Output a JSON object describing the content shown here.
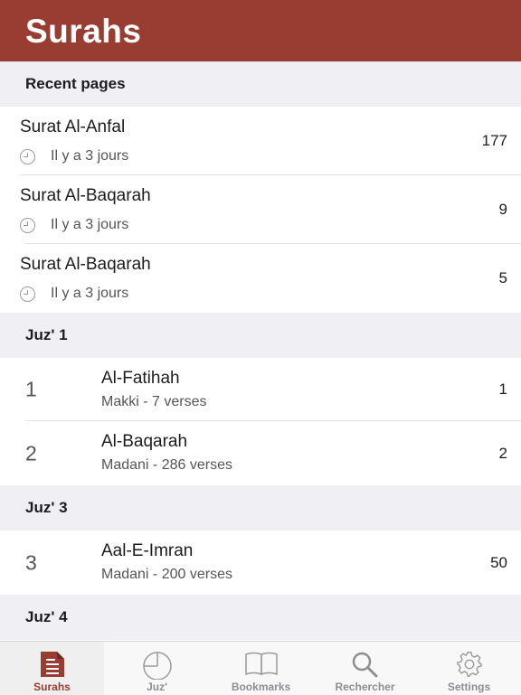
{
  "header": {
    "title": "Surahs"
  },
  "recent": {
    "header": "Recent pages",
    "items": [
      {
        "name": "Surat Al-Anfal",
        "time": "Il y a 3 jours",
        "page": "177"
      },
      {
        "name": "Surat Al-Baqarah",
        "time": "Il y a 3 jours",
        "page": "9"
      },
      {
        "name": "Surat Al-Baqarah",
        "time": "Il y a 3 jours",
        "page": "5"
      }
    ]
  },
  "sections": [
    {
      "header": "Juz' 1",
      "items": [
        {
          "number": "1",
          "name": "Al-Fatihah",
          "info": "Makki - 7 verses",
          "juz": "1"
        },
        {
          "number": "2",
          "name": "Al-Baqarah",
          "info": "Madani - 286 verses",
          "juz": "2"
        }
      ]
    },
    {
      "header": "Juz' 3",
      "items": [
        {
          "number": "3",
          "name": "Aal-E-Imran",
          "info": "Madani - 200 verses",
          "juz": "50"
        }
      ]
    },
    {
      "header": "Juz' 4"
    }
  ],
  "tabbar": {
    "items": [
      {
        "label": "Surahs",
        "icon": "document-icon",
        "active": true
      },
      {
        "label": "Juz'",
        "icon": "pie-chart-icon"
      },
      {
        "label": "Bookmarks",
        "icon": "book-icon"
      },
      {
        "label": "Rechercher",
        "icon": "search-icon"
      },
      {
        "label": "Settings",
        "icon": "gear-icon"
      }
    ]
  },
  "colors": {
    "brand": "#993d32",
    "section_bg": "#efeff4",
    "tab_inactive": "#8e8e93"
  }
}
